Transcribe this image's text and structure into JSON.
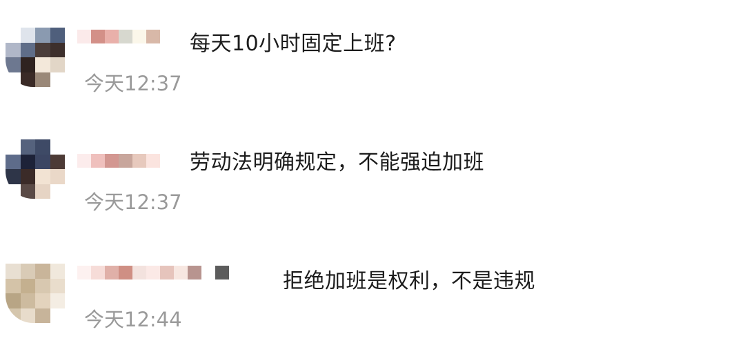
{
  "comments": [
    {
      "text": "每天10小时固定上班?",
      "time": "今天12:37",
      "avatar_colors": [
        "#ffffff",
        "#dfe4ec",
        "#8a9ab0",
        "#4f5f7c",
        "#b0b7c8",
        "#5f6d88",
        "#4a3d3a",
        "#3d2f2c",
        "#6d7890",
        "#2f2320",
        "#f3e8da",
        "#e2d6c7",
        "#ffffff",
        "#3a2a26",
        "#9a8878",
        "#ffffff"
      ],
      "username_colors": [
        "#fbeaea",
        "#d39088",
        "#e9b0aa",
        "#d7d8cf",
        "#fbf7ea",
        "#d8b8a8"
      ]
    },
    {
      "text": "劳动法明确规定，不能强迫加班",
      "time": "今天12:37",
      "avatar_colors": [
        "#ffffff",
        "#55627d",
        "#3e4a66",
        "#ffffff",
        "#5e6c8a",
        "#1d2238",
        "#3c4663",
        "#4d3b36",
        "#2e3548",
        "#3b2b28",
        "#f2e3d3",
        "#ead8c8",
        "#ffffff",
        "#5a4a46",
        "#e6d4c4",
        "#ffffff"
      ],
      "username_colors": [
        "#fcecec",
        "#efc0bd",
        "#d39791",
        "#c8a69c",
        "#e7c9bd",
        "#fbe4df"
      ]
    },
    {
      "text": "拒绝加班是权利，不是违规",
      "time": "今天12:44",
      "avatar_colors": [
        "#e8dfd2",
        "#d9cbb6",
        "#c9b59a",
        "#f0e8dc",
        "#d4c3a8",
        "#c4b08f",
        "#d8c8b0",
        "#e9ddcc",
        "#b8a585",
        "#cdbb9f",
        "#e3d3bd",
        "#f4ede3",
        "#d5c6ad",
        "#e8dccb",
        "#c7b49a",
        "#ffffff"
      ],
      "username_colors": [
        "#fdf1f0",
        "#f6dcd8",
        "#e0b0a8",
        "#cf8f84",
        "#f3e2de",
        "#fbe9e6",
        "#e6c4bc",
        "#f7e7e1",
        "#b8948f",
        "#ffffff",
        "#5c5c5c"
      ]
    }
  ]
}
